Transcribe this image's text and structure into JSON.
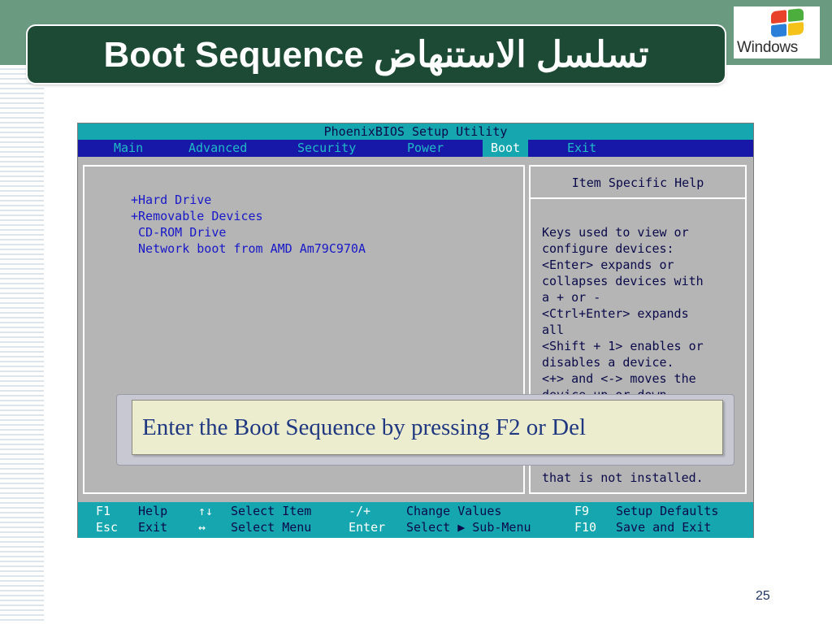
{
  "slide": {
    "title": "Boot Sequence تسلسل الاستنهاض",
    "logo_text": "Windows",
    "page_number": "25",
    "callout": "Enter the Boot Sequence by pressing F2 or Del"
  },
  "bios": {
    "title": "PhoenixBIOS Setup Utility",
    "menu": [
      "Main",
      "Advanced",
      "Security",
      "Power",
      "Boot",
      "Exit"
    ],
    "active_menu": "Boot",
    "boot_items": [
      "+Hard Drive",
      "+Removable Devices",
      " CD-ROM Drive",
      " Network boot from AMD Am79C970A"
    ],
    "help_title": "Item Specific Help",
    "help_lines": [
      "Keys used to view or",
      "configure devices:",
      "<Enter> expands or",
      "collapses devices with",
      "a + or -",
      "<Ctrl+Enter> expands",
      "all",
      "<Shift + 1> enables or",
      "disables a device.",
      "<+> and <-> moves the",
      "device up or down.",
      "that is not installed."
    ],
    "footer": {
      "row1": [
        "F1",
        "Help",
        "↑↓",
        "Select Item",
        "-/+",
        "Change Values",
        "F9",
        "Setup Defaults"
      ],
      "row2": [
        "Esc",
        "Exit",
        "↔",
        "Select Menu",
        "Enter",
        "Select ▶ Sub-Menu",
        "F10",
        "Save and Exit"
      ]
    }
  },
  "colors": {
    "title_bg": "#1d4a35",
    "bios_cyan": "#16a6b0",
    "bios_blue": "#1818a8",
    "callout_text": "#1f3880"
  }
}
